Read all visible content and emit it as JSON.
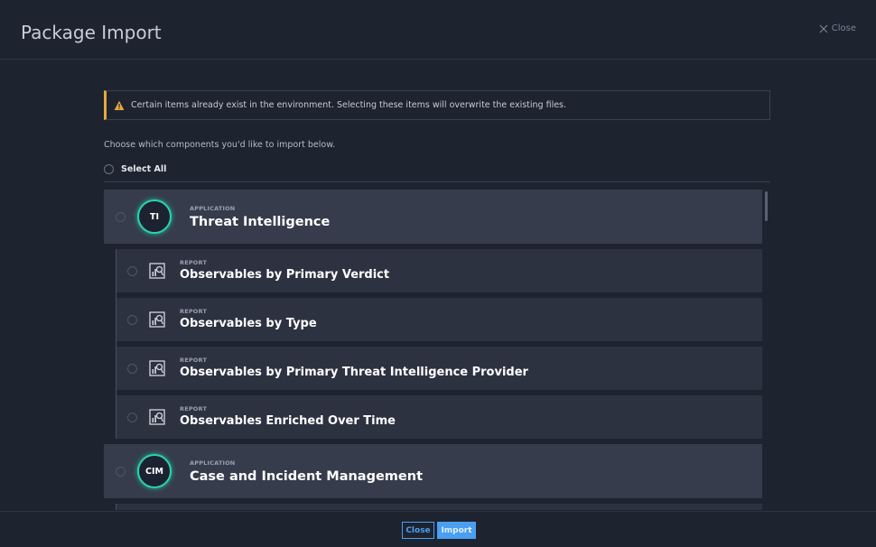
{
  "dialog": {
    "title": "Package Import",
    "close_label": "Close"
  },
  "warning": {
    "text": "Certain items already exist in the environment. Selecting these items will overwrite the existing files.",
    "color": "#e8a93a"
  },
  "instructions": "Choose which components you'd like to import below.",
  "select_all_label": "Select All",
  "components": [
    {
      "type_label": "APPLICATION",
      "badge": "TI",
      "name": "Threat Intelligence",
      "children": [
        {
          "type_label": "REPORT",
          "name": "Observables by Primary Verdict"
        },
        {
          "type_label": "REPORT",
          "name": "Observables by Type"
        },
        {
          "type_label": "REPORT",
          "name": "Observables by Primary Threat Intelligence Provider"
        },
        {
          "type_label": "REPORT",
          "name": "Observables Enriched Over Time"
        }
      ]
    },
    {
      "type_label": "APPLICATION",
      "badge": "CIM",
      "name": "Case and Incident Management",
      "children": []
    }
  ],
  "footer": {
    "close_label": "Close",
    "import_label": "Import",
    "accent_color": "#4a9ff0"
  },
  "theme": {
    "badge_ring_color": "#2bd3b0"
  }
}
